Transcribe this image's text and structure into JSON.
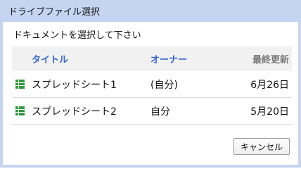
{
  "dialog": {
    "title": "ドライブファイル選択",
    "prompt": "ドキュメントを選択して下さい"
  },
  "table": {
    "headers": {
      "title": "タイトル",
      "owner": "オーナー",
      "updated": "最終更新"
    },
    "rows": [
      {
        "name": "スプレッドシート1",
        "owner": "(自分)",
        "updated": "6月26日",
        "icon": "spreadsheet-icon"
      },
      {
        "name": "スプレッドシート2",
        "owner": "自分",
        "updated": "5月20日",
        "icon": "spreadsheet-icon"
      }
    ]
  },
  "footer": {
    "cancel_label": "キャンセル"
  },
  "colors": {
    "title_bar": "#c4d4f1",
    "header_link": "#3366cc",
    "sheet_icon": "#2e9a3e"
  }
}
